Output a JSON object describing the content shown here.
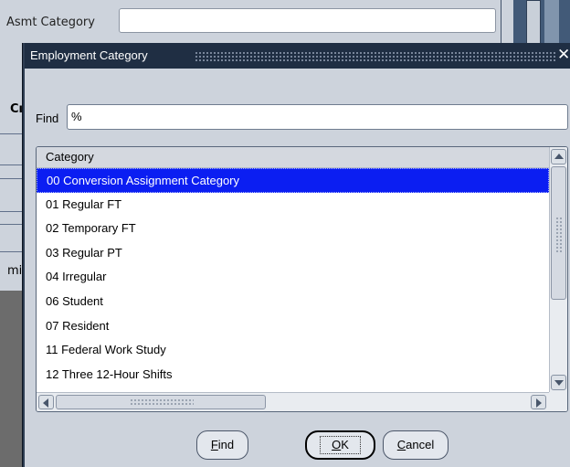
{
  "background_form": {
    "asmt_category_label": "Asmt Category",
    "asmt_category_value": "",
    "peek_label_1": "Cı",
    "peek_label_2": "mi"
  },
  "dialog": {
    "title": "Employment Category",
    "close_glyph": "✕",
    "find_label": "Find",
    "find_value": "%",
    "list": {
      "column_header": "Category",
      "selected_index": 0,
      "rows": [
        "00 Conversion Assignment Category",
        "01 Regular FT",
        "02 Temporary FT",
        "03 Regular PT",
        "04 Irregular",
        "06 Student",
        "07 Resident",
        "11 Federal Work Study",
        "12 Three 12-Hour Shifts"
      ]
    },
    "buttons": {
      "find": {
        "mnemonic": "F",
        "rest": "ind"
      },
      "ok": {
        "mnemonic": "O",
        "rest": "K"
      },
      "cancel": {
        "mnemonic": "C",
        "rest": "ancel"
      }
    }
  },
  "colors": {
    "titlebar": "#1f2e43",
    "selection": "#0b1ef2",
    "dialog_bg": "#cdd3dc"
  },
  "icons": {
    "scroll_up": "triangle-up-icon",
    "scroll_down": "triangle-down-icon",
    "scroll_left": "triangle-left-icon",
    "scroll_right": "triangle-right-icon",
    "close": "close-icon"
  }
}
